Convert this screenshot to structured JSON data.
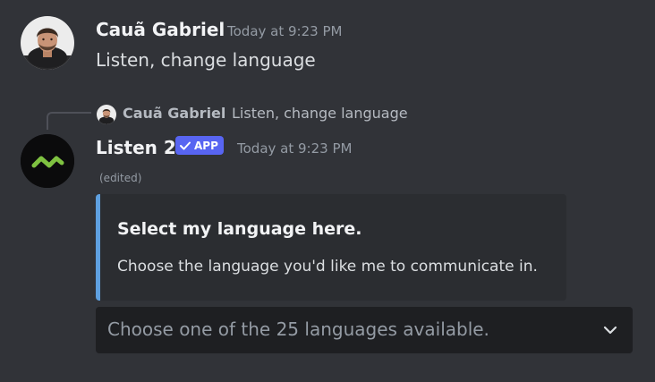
{
  "message1": {
    "author": "Cauã Gabriel",
    "timestamp": "Today at 9:23 PM",
    "text": "Listen, change language"
  },
  "message2": {
    "reply": {
      "author": "Cauã Gabriel",
      "text": "Listen, change language"
    },
    "author": "Listen 2",
    "badge": "APP",
    "timestamp": "Today at 9:23 PM",
    "edited": "(edited)",
    "embed": {
      "title": "Select my language here.",
      "description": "Choose the language you'd like me to communicate in.",
      "accent_color": "#5ea0e0"
    },
    "select_menu": {
      "placeholder": "Choose one of the 25 languages available."
    }
  },
  "colors": {
    "background": "#313338",
    "badge": "#5865f2",
    "embed_background": "#2b2d31",
    "select_background": "#1e1f22",
    "bot_logo": "#7fc241"
  }
}
